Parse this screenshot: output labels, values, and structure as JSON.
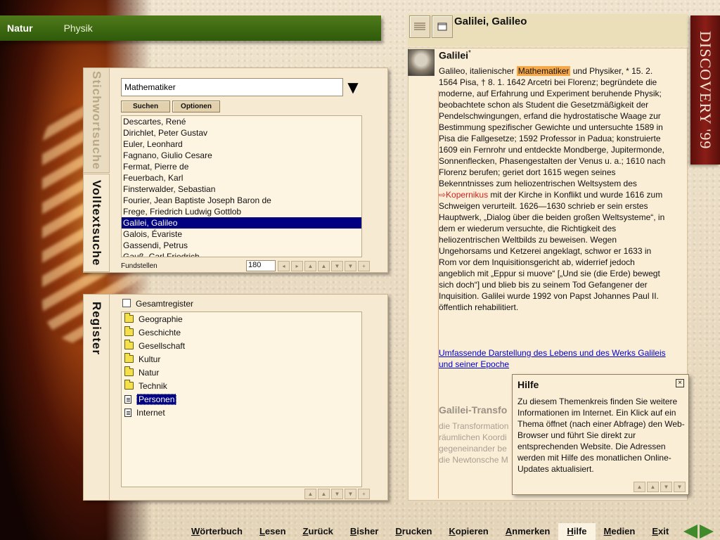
{
  "categories": {
    "active": "Natur",
    "inactive": "Physik"
  },
  "tabs": {
    "stichwort": "Stichwortsuche",
    "volltext": "Volltextsuche",
    "register": "Register"
  },
  "search": {
    "value": "Mathematiker",
    "suchen_label": "Suchen",
    "optionen_label": "Optionen",
    "results": [
      "Descartes, René",
      "Dirichlet, Peter Gustav",
      "Euler, Leonhard",
      "Fagnano, Giulio Cesare",
      "Fermat, Pierre de",
      "Feuerbach, Karl",
      "Finsterwalder, Sebastian",
      "Fourier, Jean Baptiste Joseph Baron de",
      "Frege, Friedrich Ludwig Gottlob",
      "Galilei, Galileo",
      "Galois, Évariste",
      "Gassendi, Petrus",
      "Gauß, Carl Friedrich"
    ],
    "selected_index": 9,
    "fundstellen_label": "Fundstellen",
    "fundstellen_value": "180"
  },
  "register": {
    "gesamt_label": "Gesamtregister",
    "items": [
      {
        "label": "Geographie",
        "icon": "folder-icon"
      },
      {
        "label": "Geschichte",
        "icon": "folder-icon"
      },
      {
        "label": "Gesellschaft",
        "icon": "folder-icon"
      },
      {
        "label": "Kultur",
        "icon": "folder-icon"
      },
      {
        "label": "Natur",
        "icon": "folder-icon"
      },
      {
        "label": "Technik",
        "icon": "folder-icon"
      },
      {
        "label": "Personen",
        "icon": "document-icon",
        "selected": true
      },
      {
        "label": "Internet",
        "icon": "document-icon"
      }
    ]
  },
  "article": {
    "title": "Galilei, Galileo",
    "headword": "Galilei",
    "headword_mark": "*",
    "text_pre": "Galileo, italienischer ",
    "highlight": "Mathematiker",
    "text_mid": " und Physiker, * 15. 2. 1564 Pisa, † 8. 1. 1642 Arcetri bei Florenz; begründete die moderne, auf Erfahrung und Experiment beruhende Physik; beobachtete schon als Student die Gesetzmäßigkeit der Pendelschwingungen, erfand die hydrostatische Waage zur Bestimmung spezifischer Gewichte und untersuchte 1589 in Pisa die Fallgesetze; 1592 Professor in Padua; konstruierte 1609 ein Fernrohr und entdeckte Mondberge, Jupitermonde, Sonnenflecken, Phasengestalten der Venus u. a.; 1610 nach Florenz berufen; geriet dort 1615 wegen seines Bekenntnisses zum heliozentrischen Weltsystem des ",
    "xref": "⇨Kopernikus",
    "text_post": " mit der Kirche in Konflikt und wurde 1616 zum Schweigen verurteilt. 1626—1630 schrieb er sein erstes Hauptwerk, „Dialog über die beiden großen Weltsysteme“, in dem er wiederum versuchte, die Richtigkeit des heliozentrischen Weltbilds zu beweisen. Wegen Ungehorsams und Ketzerei angeklagt, schwor er 1633 in Rom vor dem Inquisitionsgericht ab, widerrief jedoch angeblich mit „Eppur si muove“ [„Und sie (die Erde) bewegt sich doch“] und blieb bis zu seinem Tod Gefangener der Inquisition. Galilei wurde 1992 von Papst Johannes Paul II. öffentlich rehabilitiert.",
    "link": "Umfassende Darstellung des Lebens und des Werks Galileis und seiner Epoche",
    "sub_title": "Galilei-Transfo",
    "sub_lines": [
      "die Transformation",
      "räumlichen Koordi",
      "gegeneinander be",
      "die Newtonsche M"
    ]
  },
  "help": {
    "title": "Hilfe",
    "body": "Zu diesem Themenkreis finden Sie weitere Informationen im Internet. Ein Klick auf ein Thema öffnet (nach einer Abfrage) den Web-Browser und führt Sie direkt zur entsprechenden Website. Die Adressen werden mit Hilfe des monatlichen Online-Updates aktualisiert."
  },
  "banner": "DISCOVERY '99",
  "menu": [
    {
      "first": "W",
      "rest": "örterbuch"
    },
    {
      "first": "L",
      "rest": "esen"
    },
    {
      "first": "Z",
      "rest": "urück"
    },
    {
      "first": "B",
      "rest": "isher"
    },
    {
      "first": "D",
      "rest": "rucken"
    },
    {
      "first": "K",
      "rest": "opieren"
    },
    {
      "first": "A",
      "rest": "nmerken"
    },
    {
      "first": "H",
      "rest": "ilfe",
      "active": true
    },
    {
      "first": "M",
      "rest": "edien"
    },
    {
      "first": "E",
      "rest": "xit"
    }
  ],
  "colors": {
    "selection": "#000080",
    "highlight": "#f7a94a",
    "xref": "#d21f1f",
    "link": "#0000cc",
    "banner": "#8b1e17",
    "catbar": "#3f6a12"
  }
}
